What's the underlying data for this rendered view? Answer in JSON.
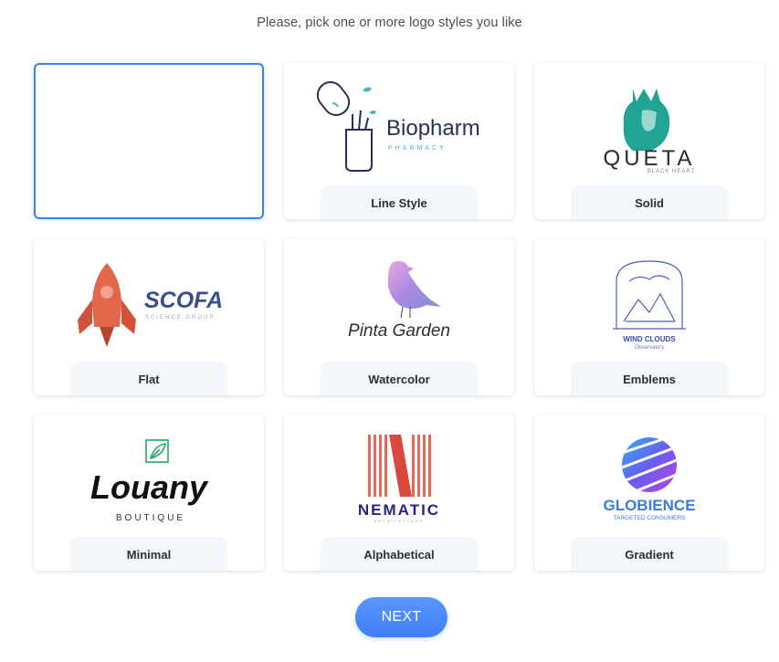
{
  "prompt": "Please, pick one or more logo styles you like",
  "next_label": "NEXT",
  "colors": {
    "accent": "#3f7ef5",
    "selected_border": "#3b82e6",
    "label_bg": "#f3f7fc"
  },
  "styles": [
    {
      "label": "",
      "selected": true
    },
    {
      "label": "Line Style",
      "logo": {
        "name": "Biopharm",
        "tagline": "PHARMACY"
      }
    },
    {
      "label": "Solid",
      "logo": {
        "name": "QUETA",
        "tagline": "BLACK HEART"
      }
    },
    {
      "label": "Flat",
      "logo": {
        "name": "SCOFA",
        "tagline": "SCIENCE GROUP"
      }
    },
    {
      "label": "Watercolor",
      "logo": {
        "name": "Pinta Garden"
      }
    },
    {
      "label": "Emblems",
      "logo": {
        "name": "WIND CLOUDS",
        "tagline": "Observatory"
      }
    },
    {
      "label": "Minimal",
      "logo": {
        "name": "Louany",
        "tagline": "BOUTIQUE"
      }
    },
    {
      "label": "Alphabetical",
      "logo": {
        "name": "NEMATIC",
        "tagline": "ARCHITECTURE"
      }
    },
    {
      "label": "Gradient",
      "logo": {
        "name": "GLOBIENCE",
        "tagline": "TARGETED CONSUMERS"
      }
    }
  ]
}
